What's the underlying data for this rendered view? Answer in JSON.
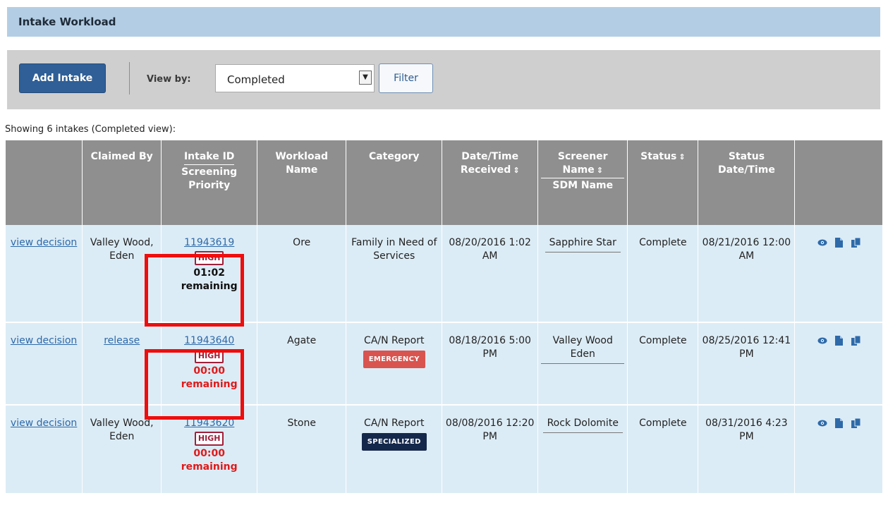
{
  "title": "Intake Workload",
  "toolbar": {
    "add_label": "Add Intake",
    "viewby_label": "View by:",
    "view_value": "Completed",
    "filter_label": "Filter"
  },
  "showing_text": "Showing 6 intakes (Completed view):",
  "columns": {
    "claimed_by": "Claimed By",
    "intake_id": "Intake ID",
    "screening_priority": "Screening Priority",
    "workload_name": "Workload Name",
    "category": "Category",
    "date_received": "Date/Time Received",
    "screener_name": "Screener Name",
    "sdm_name": "SDM Name",
    "status": "Status",
    "status_datetime": "Status Date/Time",
    "sort_glyph": "⇕"
  },
  "rows": [
    {
      "action": "view decision",
      "claimed": "Valley Wood, Eden",
      "intake_id": "11943619",
      "priority": "HIGH",
      "remaining_time": "01:02",
      "remaining_label": "remaining",
      "workload": "Ore",
      "category": "Family in Need of Services",
      "category_tag": "",
      "received": "08/20/2016 1:02 AM",
      "screener": "Sapphire Star",
      "status": "Complete",
      "status_dt": "08/21/2016 12:00 AM"
    },
    {
      "action": "view decision",
      "claimed": "release",
      "intake_id": "11943640",
      "priority": "HIGH",
      "remaining_time": "00:00",
      "remaining_label": "remaining",
      "workload": "Agate",
      "category": "CA/N Report",
      "category_tag": "EMERGENCY",
      "received": "08/18/2016 5:00 PM",
      "screener": "Valley Wood Eden",
      "status": "Complete",
      "status_dt": "08/25/2016 12:41 PM"
    },
    {
      "action": "view decision",
      "claimed": "Valley Wood, Eden",
      "intake_id": "11943620",
      "priority": "HIGH",
      "remaining_time": "00:00",
      "remaining_label": "remaining",
      "workload": "Stone",
      "category": "CA/N Report",
      "category_tag": "SPECIALIZED",
      "received": "08/08/2016 12:20 PM",
      "screener": "Rock Dolomite",
      "status": "Complete",
      "status_dt": "08/31/2016 4:23 PM"
    }
  ],
  "colors": {
    "title_bg": "#b3cee4",
    "row_bg": "#dcecf6",
    "header_bg": "#8f8f8f",
    "link": "#2e6aa9",
    "emergency": "#d9534f",
    "specialized": "#14284b",
    "alert": "#ef0d0d"
  },
  "icons": [
    "eye-icon",
    "document-icon",
    "copy-icon"
  ]
}
